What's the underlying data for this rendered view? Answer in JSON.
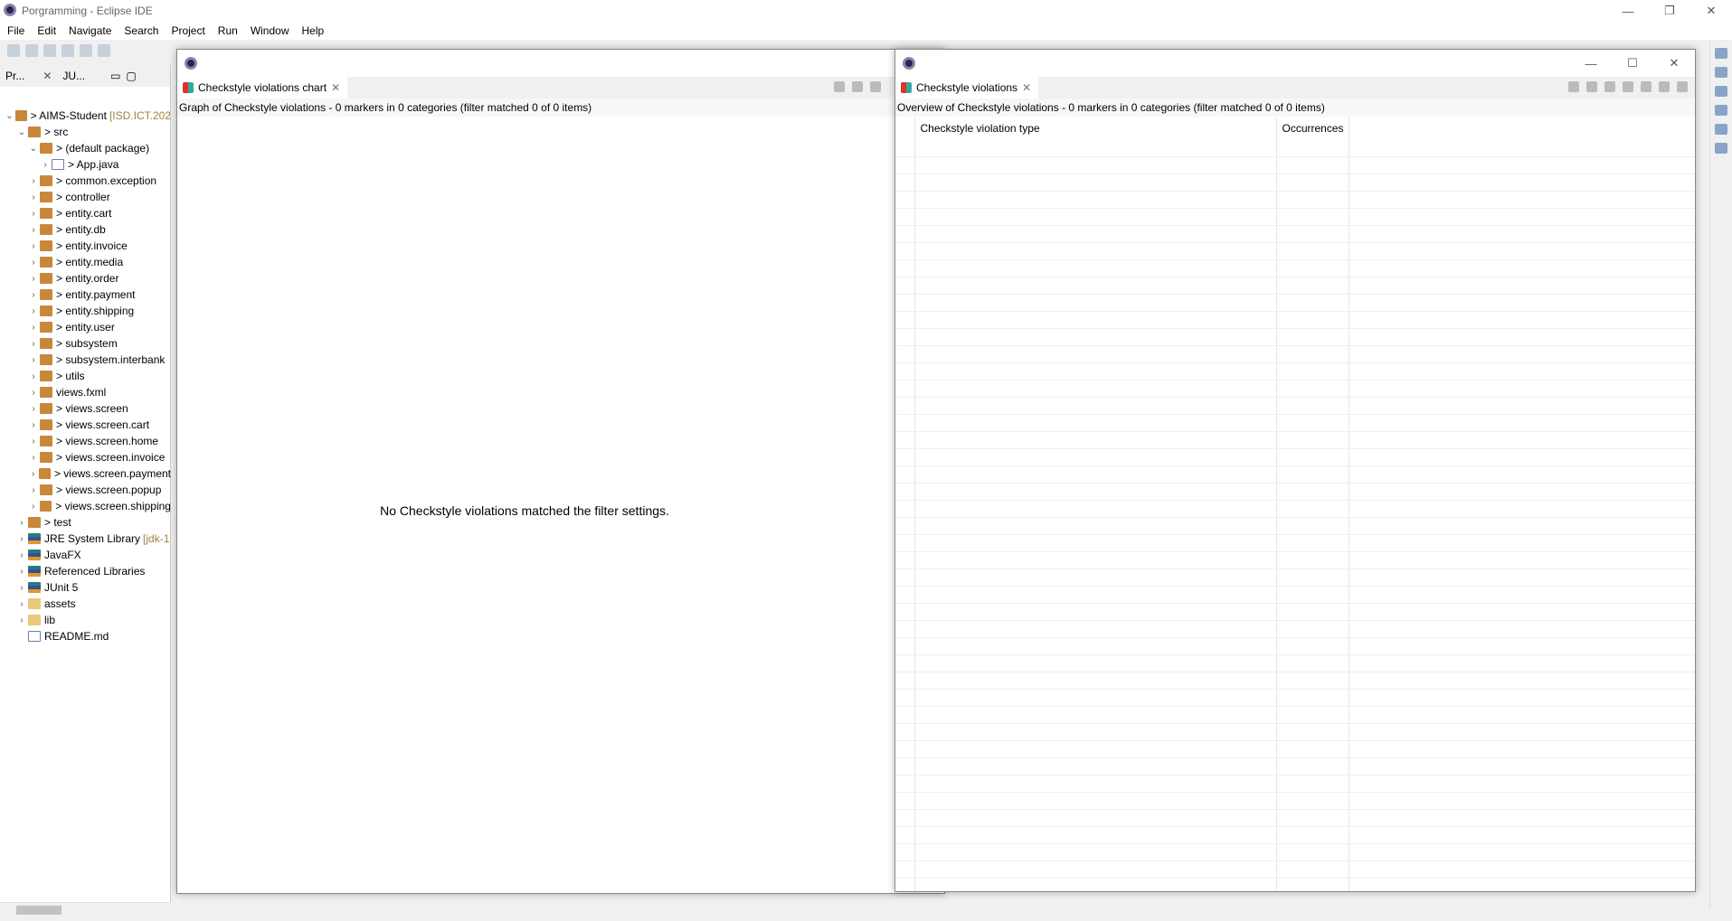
{
  "window": {
    "title": "Porgramming - Eclipse IDE",
    "min": "—",
    "restore": "❐",
    "close": "✕"
  },
  "menu": [
    "File",
    "Edit",
    "Navigate",
    "Search",
    "Project",
    "Run",
    "Window",
    "Help"
  ],
  "left_panel": {
    "tabs": [
      {
        "label": "Pr..."
      },
      {
        "label": "JU..."
      }
    ],
    "tree": [
      {
        "label": "> AIMS-Student",
        "extra": "[ISD.ICT.202",
        "chev": "⌄",
        "level": 0,
        "icon": "project"
      },
      {
        "label": "> src",
        "chev": "⌄",
        "level": 1,
        "icon": "package-folder"
      },
      {
        "label": "> (default package)",
        "chev": "⌄",
        "level": 2,
        "icon": "package"
      },
      {
        "label": "> App.java",
        "chev": "›",
        "level": 3,
        "icon": "file"
      },
      {
        "label": "> common.exception",
        "chev": "›",
        "level": 2,
        "icon": "package"
      },
      {
        "label": "> controller",
        "chev": "›",
        "level": 2,
        "icon": "package"
      },
      {
        "label": "> entity.cart",
        "chev": "›",
        "level": 2,
        "icon": "package"
      },
      {
        "label": "> entity.db",
        "chev": "›",
        "level": 2,
        "icon": "package"
      },
      {
        "label": "> entity.invoice",
        "chev": "›",
        "level": 2,
        "icon": "package"
      },
      {
        "label": "> entity.media",
        "chev": "›",
        "level": 2,
        "icon": "package"
      },
      {
        "label": "> entity.order",
        "chev": "›",
        "level": 2,
        "icon": "package"
      },
      {
        "label": "> entity.payment",
        "chev": "›",
        "level": 2,
        "icon": "package"
      },
      {
        "label": "> entity.shipping",
        "chev": "›",
        "level": 2,
        "icon": "package"
      },
      {
        "label": "> entity.user",
        "chev": "›",
        "level": 2,
        "icon": "package"
      },
      {
        "label": "> subsystem",
        "chev": "›",
        "level": 2,
        "icon": "package"
      },
      {
        "label": "> subsystem.interbank",
        "chev": "›",
        "level": 2,
        "icon": "package"
      },
      {
        "label": "> utils",
        "chev": "›",
        "level": 2,
        "icon": "package"
      },
      {
        "label": "views.fxml",
        "chev": "›",
        "level": 2,
        "icon": "package"
      },
      {
        "label": "> views.screen",
        "chev": "›",
        "level": 2,
        "icon": "package"
      },
      {
        "label": "> views.screen.cart",
        "chev": "›",
        "level": 2,
        "icon": "package"
      },
      {
        "label": "> views.screen.home",
        "chev": "›",
        "level": 2,
        "icon": "package"
      },
      {
        "label": "> views.screen.invoice",
        "chev": "›",
        "level": 2,
        "icon": "package"
      },
      {
        "label": "> views.screen.payment",
        "chev": "›",
        "level": 2,
        "icon": "package"
      },
      {
        "label": "> views.screen.popup",
        "chev": "›",
        "level": 2,
        "icon": "package"
      },
      {
        "label": "> views.screen.shipping",
        "chev": "›",
        "level": 2,
        "icon": "package"
      },
      {
        "label": "> test",
        "chev": "›",
        "level": 1,
        "icon": "package-folder"
      },
      {
        "label": "JRE System Library",
        "extra": "[jdk-1",
        "chev": "›",
        "level": 1,
        "icon": "library"
      },
      {
        "label": "JavaFX",
        "chev": "›",
        "level": 1,
        "icon": "library"
      },
      {
        "label": "Referenced Libraries",
        "chev": "›",
        "level": 1,
        "icon": "library"
      },
      {
        "label": "JUnit 5",
        "chev": "›",
        "level": 1,
        "icon": "library"
      },
      {
        "label": "assets",
        "chev": "›",
        "level": 1,
        "icon": "folder"
      },
      {
        "label": "lib",
        "chev": "›",
        "level": 1,
        "icon": "folder"
      },
      {
        "label": "README.md",
        "chev": "",
        "level": 1,
        "icon": "file"
      }
    ]
  },
  "chart_view": {
    "tab": "Checkstyle violations chart",
    "info": "Graph of Checkstyle violations - 0 markers in 0 categories (filter matched 0 of 0 items)",
    "message": "No Checkstyle violations matched the filter settings."
  },
  "violations_view": {
    "tab": "Checkstyle violations",
    "info": "Overview of Checkstyle violations - 0 markers in 0 categories (filter matched 0 of 0 items)",
    "columns": [
      "Checkstyle violation type",
      "Occurrences"
    ]
  }
}
